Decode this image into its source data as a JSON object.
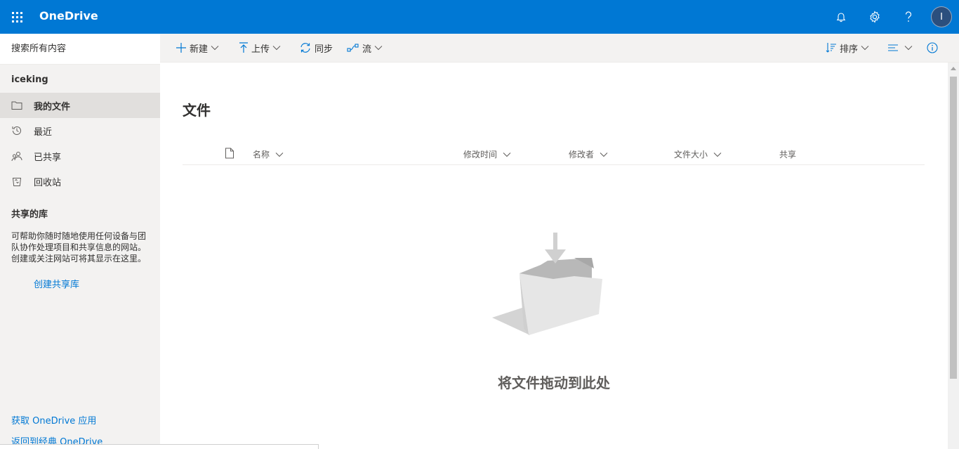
{
  "app": {
    "title": "OneDrive",
    "brand_color": "#0078d4",
    "avatar_initial": "I"
  },
  "search": {
    "placeholder": "搜索所有内容"
  },
  "sidebar": {
    "user": "iceking",
    "items": [
      {
        "label": "我的文件",
        "icon": "folder-icon",
        "active": true
      },
      {
        "label": "最近",
        "icon": "history-icon",
        "active": false
      },
      {
        "label": "已共享",
        "icon": "people-icon",
        "active": false
      },
      {
        "label": "回收站",
        "icon": "recycle-bin-icon",
        "active": false
      }
    ],
    "shared_libraries": {
      "title": "共享的库",
      "description": "可帮助你随时随地使用任何设备与团队协作处理项目和共享信息的网站。创建或关注网站可将其显示在这里。",
      "create_link": "创建共享库"
    },
    "footer_links": [
      "获取 OneDrive 应用",
      "返回到经典 OneDrive"
    ]
  },
  "commandbar": {
    "new": "新建",
    "upload": "上传",
    "sync": "同步",
    "flow": "流",
    "sort": "排序"
  },
  "main": {
    "title": "文件",
    "columns": [
      "名称",
      "修改时间",
      "修改者",
      "文件大小",
      "共享"
    ],
    "empty_message": "将文件拖动到此处"
  }
}
